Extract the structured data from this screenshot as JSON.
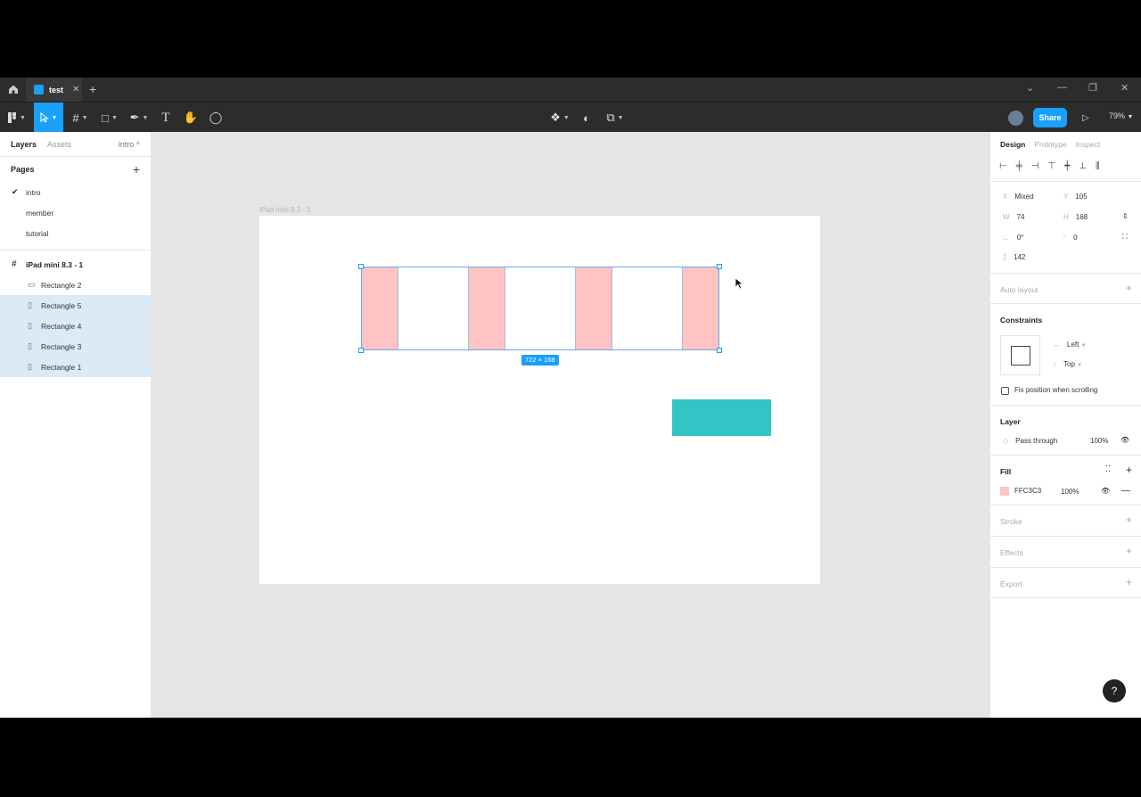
{
  "titlebar": {
    "tab_name": "test",
    "tab_close": "✕",
    "new_tab": "+",
    "win_chevron": "⌄",
    "win_min": "—",
    "win_restore": "❐",
    "win_close": "✕"
  },
  "toolbar": {
    "share_label": "Share",
    "zoom": "79%"
  },
  "left_panel": {
    "tabs": {
      "layers": "Layers",
      "assets": "Assets",
      "page_select": "intro ^"
    },
    "pages_header": "Pages",
    "pages": [
      "intro",
      "member",
      "tutorial"
    ],
    "active_page": "intro",
    "layers": {
      "frame": "iPad mini 8.3 - 1",
      "children": [
        "Rectangle 2",
        "Rectangle 5",
        "Rectangle 4",
        "Rectangle 3",
        "Rectangle 1"
      ]
    }
  },
  "canvas": {
    "frame_label": "iPad mini 8.3 - 1",
    "selection_size": "722 × 168",
    "colors": {
      "pink": "#FFC3C3",
      "teal": "#33C5C5",
      "accent": "#18A0FB"
    }
  },
  "right_panel": {
    "tabs": {
      "design": "Design",
      "prototype": "Prototype",
      "inspect": "Inspect"
    },
    "x_label": "X",
    "x_value": "Mixed",
    "y_label": "Y",
    "y_value": "105",
    "w_label": "W",
    "w_value": "74",
    "h_label": "H",
    "h_value": "168",
    "rotation": "0°",
    "radius": "0",
    "spacing": "142",
    "auto_layout": "Auto layout",
    "constraints_header": "Constraints",
    "constraint_h": "Left",
    "constraint_v": "Top",
    "fix_position": "Fix position when scrolling",
    "layer_header": "Layer",
    "blend": "Pass through",
    "layer_opacity": "100%",
    "fill_header": "Fill",
    "fill_hex": "FFC3C3",
    "fill_opacity": "100%",
    "stroke": "Stroke",
    "effects": "Effects",
    "export": "Export"
  },
  "help": "?"
}
